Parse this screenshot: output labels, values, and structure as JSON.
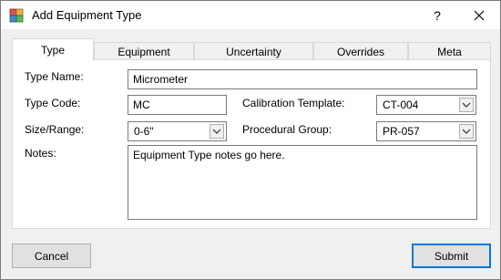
{
  "window": {
    "title": "Add Equipment Type",
    "help_label": "?"
  },
  "tabs": [
    {
      "label": "Type",
      "active": true
    },
    {
      "label": "Equipment",
      "active": false
    },
    {
      "label": "Uncertainty",
      "active": false
    },
    {
      "label": "Overrides",
      "active": false
    },
    {
      "label": "Meta",
      "active": false
    }
  ],
  "form": {
    "type_name": {
      "label": "Type Name:",
      "value": "Micrometer"
    },
    "type_code": {
      "label": "Type Code:",
      "value": "MC"
    },
    "size_range": {
      "label": "Size/Range:",
      "value": "0-6\""
    },
    "calibration_template": {
      "label": "Calibration Template:",
      "value": "CT-004"
    },
    "procedural_group": {
      "label": "Procedural Group:",
      "value": "PR-057"
    },
    "notes": {
      "label": "Notes:",
      "value": "Equipment Type notes go here."
    }
  },
  "buttons": {
    "cancel": "Cancel",
    "submit": "Submit"
  },
  "colors": {
    "accent": "#0078d7",
    "dialog_bg": "#f0f0f0",
    "panel_bg": "#ffffff"
  },
  "icons": {
    "app": "app-window-icon",
    "close": "close-icon",
    "dropdown": "chevron-down-icon"
  }
}
